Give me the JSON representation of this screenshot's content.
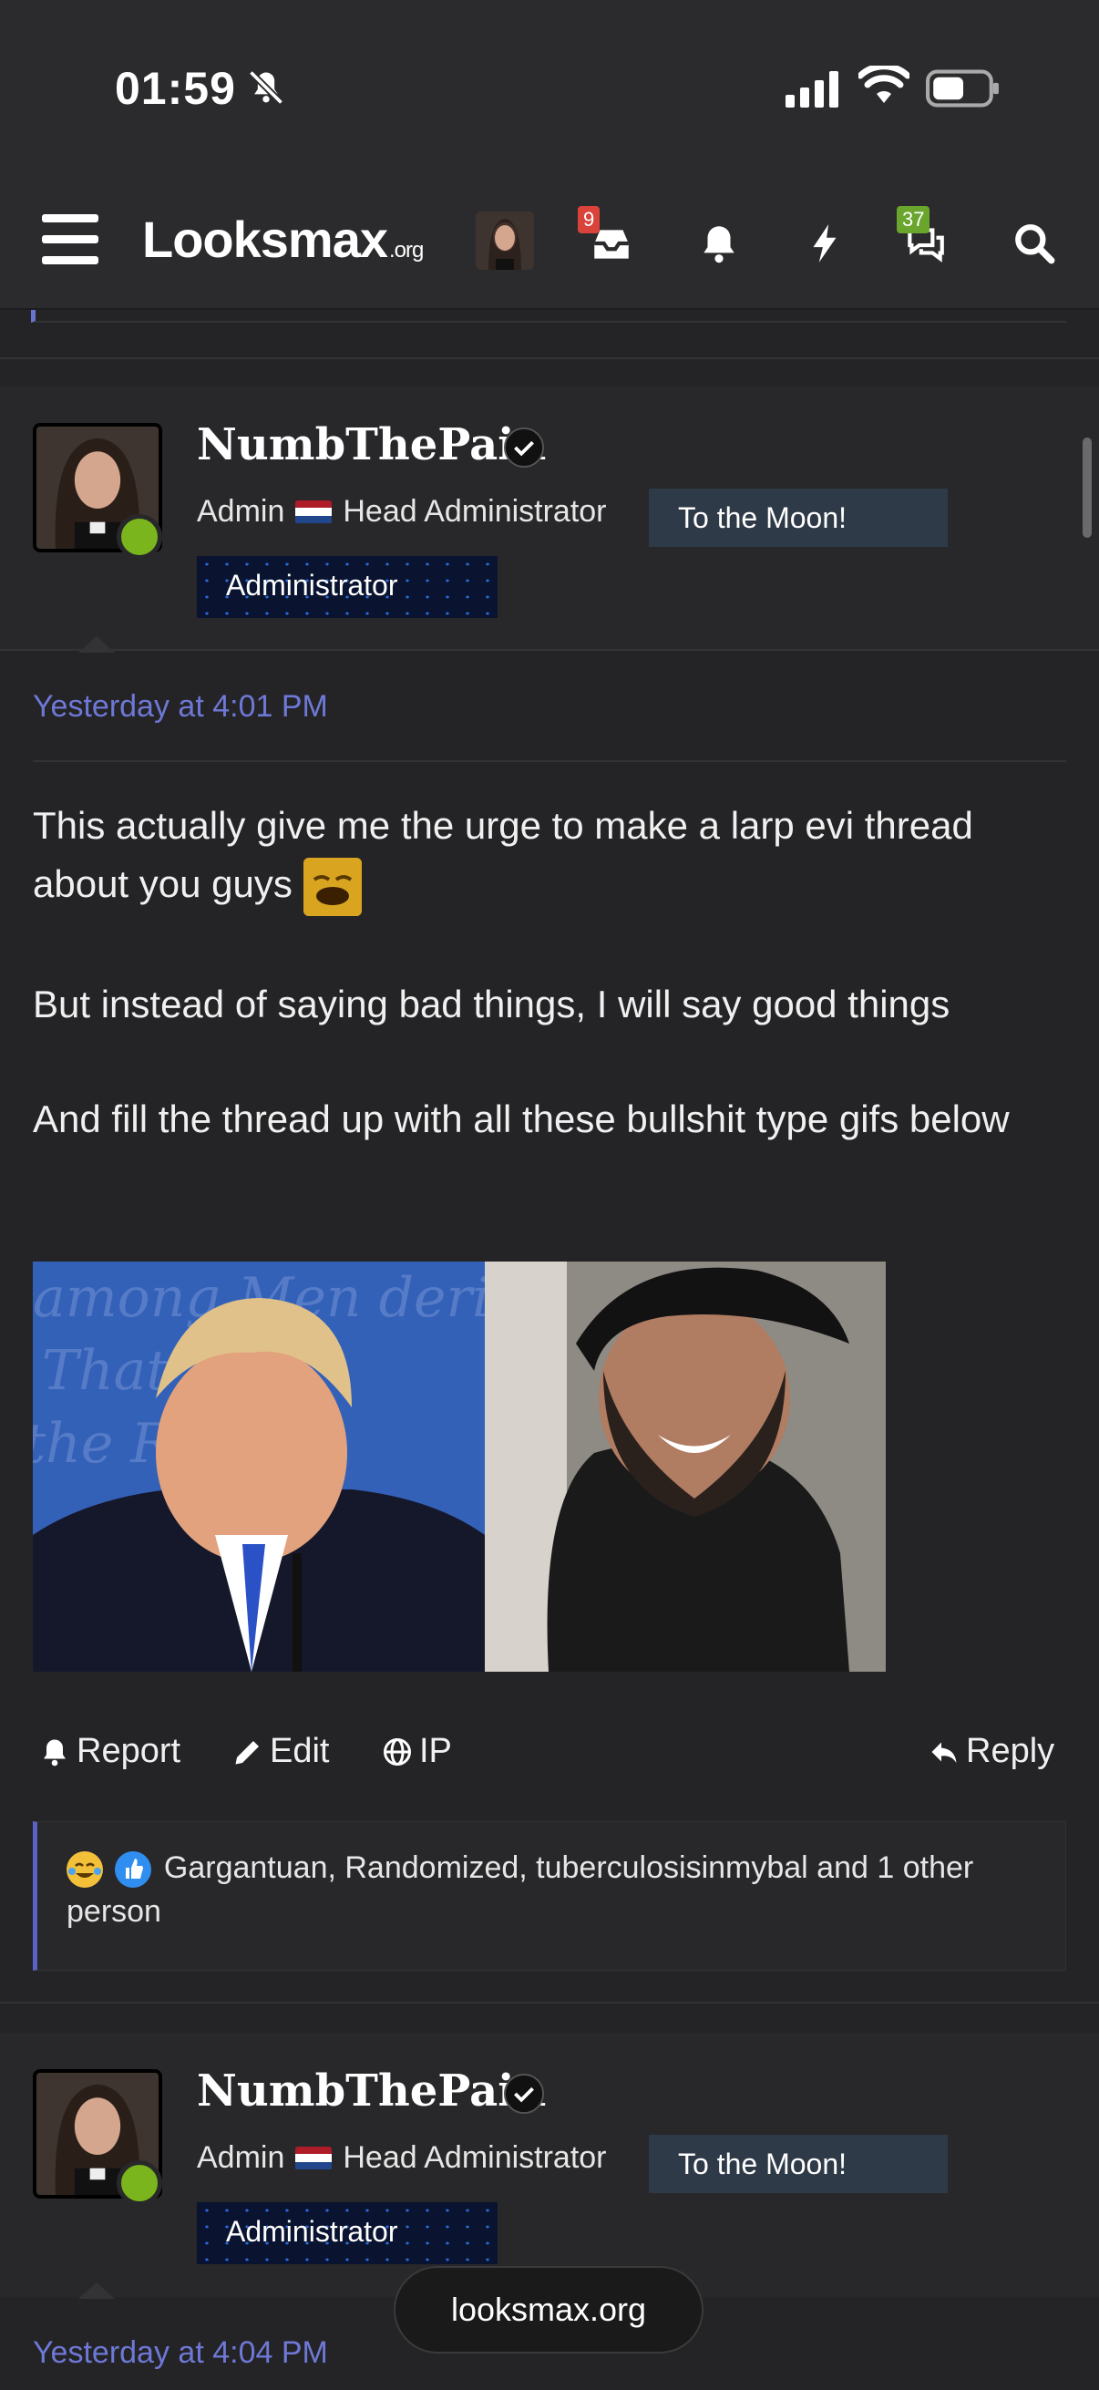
{
  "status_bar": {
    "time": "01:59"
  },
  "header": {
    "logo_text": "Looksmax",
    "logo_suffix": ".org",
    "inbox_badge": "9",
    "chat_badge": "37"
  },
  "posts": [
    {
      "username": "NumbThePain",
      "role": "Admin",
      "title": "Head Administrator",
      "banner_1": "To the Moon!",
      "banner_2": "Administrator",
      "timestamp": "Yesterday at 4:01 PM",
      "paragraphs": [
        "This actually give me the urge to make a larp evi thread about you guys",
        "But instead of saying bad things, I will say good things",
        "And fill the thread up with all these bullshit type gifs below"
      ],
      "actions": {
        "report": "Report",
        "edit": "Edit",
        "ip": "IP",
        "reply": "Reply"
      },
      "reactions_text": "Gargantuan, Randomized, tuberculosisinmybal and 1 other person"
    },
    {
      "username": "NumbThePain",
      "role": "Admin",
      "title": "Head Administrator",
      "banner_1": "To the Moon!",
      "banner_2": "Administrator",
      "timestamp": "Yesterday at 4:04 PM"
    }
  ],
  "browser": {
    "url": "looksmax.org"
  },
  "colors": {
    "accent": "#6e78d6",
    "online": "#7ab51d",
    "badge_red": "#d9433a",
    "badge_green": "#6aa52d"
  }
}
